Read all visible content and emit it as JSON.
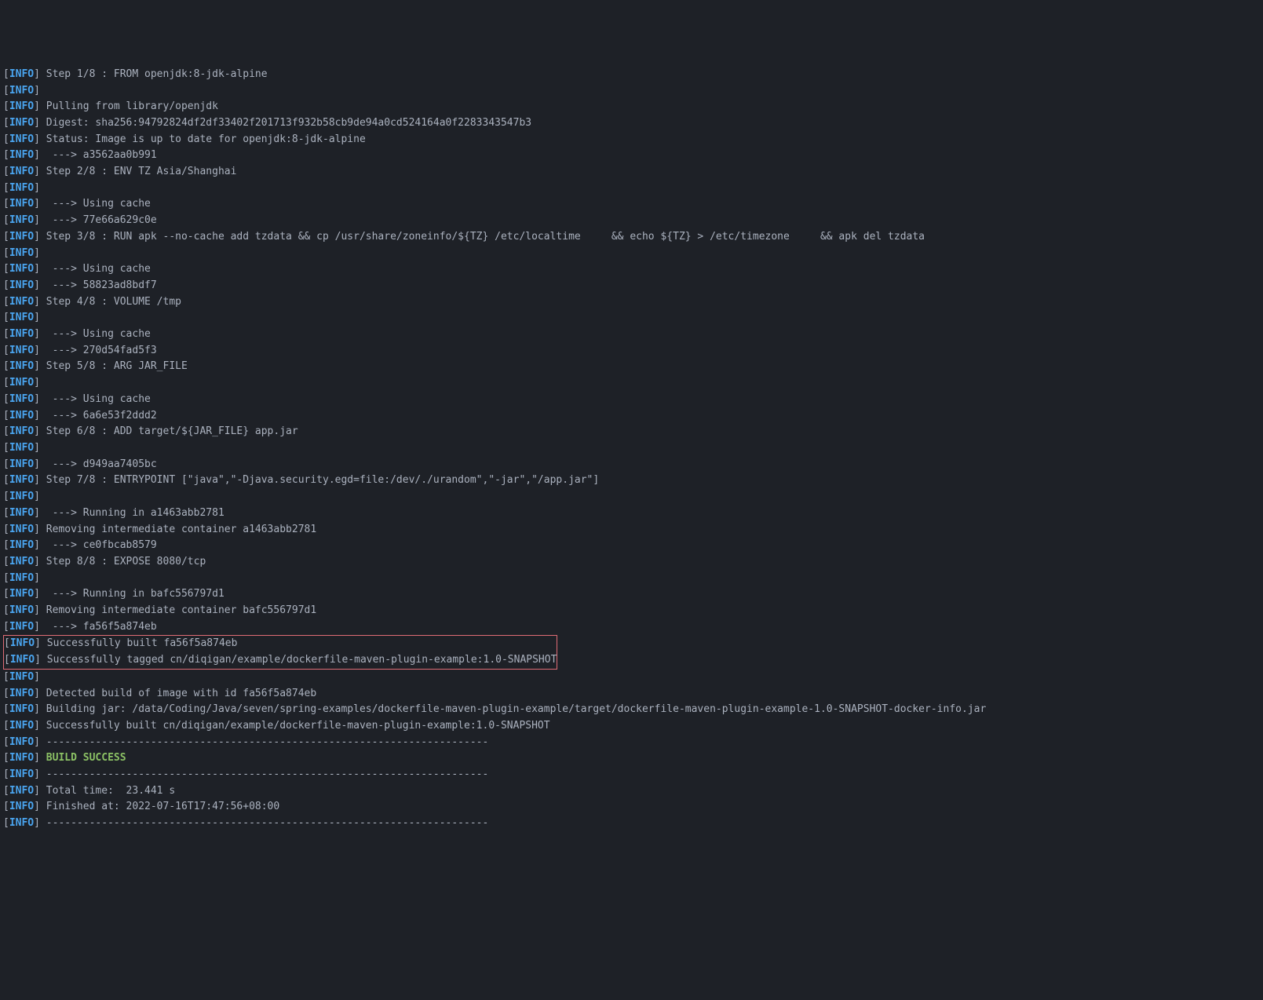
{
  "lines": [
    {
      "level": "INFO",
      "msg": "Step 1/8 : FROM openjdk:8-jdk-alpine"
    },
    {
      "level": "INFO",
      "msg": ""
    },
    {
      "level": "INFO",
      "msg": "Pulling from library/openjdk"
    },
    {
      "level": "INFO",
      "msg": "Digest: sha256:94792824df2df33402f201713f932b58cb9de94a0cd524164a0f2283343547b3"
    },
    {
      "level": "INFO",
      "msg": "Status: Image is up to date for openjdk:8-jdk-alpine"
    },
    {
      "level": "INFO",
      "msg": " ---> a3562aa0b991"
    },
    {
      "level": "INFO",
      "msg": "Step 2/8 : ENV TZ Asia/Shanghai"
    },
    {
      "level": "INFO",
      "msg": ""
    },
    {
      "level": "INFO",
      "msg": " ---> Using cache"
    },
    {
      "level": "INFO",
      "msg": " ---> 77e66a629c0e"
    },
    {
      "level": "INFO",
      "msg": "Step 3/8 : RUN apk --no-cache add tzdata && cp /usr/share/zoneinfo/${TZ} /etc/localtime     && echo ${TZ} > /etc/timezone     && apk del tzdata"
    },
    {
      "level": "INFO",
      "msg": ""
    },
    {
      "level": "INFO",
      "msg": " ---> Using cache"
    },
    {
      "level": "INFO",
      "msg": " ---> 58823ad8bdf7"
    },
    {
      "level": "INFO",
      "msg": "Step 4/8 : VOLUME /tmp"
    },
    {
      "level": "INFO",
      "msg": ""
    },
    {
      "level": "INFO",
      "msg": " ---> Using cache"
    },
    {
      "level": "INFO",
      "msg": " ---> 270d54fad5f3"
    },
    {
      "level": "INFO",
      "msg": "Step 5/8 : ARG JAR_FILE"
    },
    {
      "level": "INFO",
      "msg": ""
    },
    {
      "level": "INFO",
      "msg": " ---> Using cache"
    },
    {
      "level": "INFO",
      "msg": " ---> 6a6e53f2ddd2"
    },
    {
      "level": "INFO",
      "msg": "Step 6/8 : ADD target/${JAR_FILE} app.jar"
    },
    {
      "level": "INFO",
      "msg": ""
    },
    {
      "level": "INFO",
      "msg": " ---> d949aa7405bc"
    },
    {
      "level": "INFO",
      "msg": "Step 7/8 : ENTRYPOINT [\"java\",\"-Djava.security.egd=file:/dev/./urandom\",\"-jar\",\"/app.jar\"]"
    },
    {
      "level": "INFO",
      "msg": ""
    },
    {
      "level": "INFO",
      "msg": " ---> Running in a1463abb2781"
    },
    {
      "level": "INFO",
      "msg": "Removing intermediate container a1463abb2781"
    },
    {
      "level": "INFO",
      "msg": " ---> ce0fbcab8579"
    },
    {
      "level": "INFO",
      "msg": "Step 8/8 : EXPOSE 8080/tcp"
    },
    {
      "level": "INFO",
      "msg": ""
    },
    {
      "level": "INFO",
      "msg": " ---> Running in bafc556797d1"
    },
    {
      "level": "INFO",
      "msg": "Removing intermediate container bafc556797d1"
    },
    {
      "level": "INFO",
      "msg": " ---> fa56f5a874eb"
    }
  ],
  "highlighted": [
    {
      "level": "INFO",
      "msg": "Successfully built fa56f5a874eb"
    },
    {
      "level": "INFO",
      "msg": "Successfully tagged cn/diqigan/example/dockerfile-maven-plugin-example:1.0-SNAPSHOT"
    }
  ],
  "after": [
    {
      "level": "INFO",
      "msg": ""
    },
    {
      "level": "INFO",
      "msg": "Detected build of image with id fa56f5a874eb"
    },
    {
      "level": "INFO",
      "msg": "Building jar: /data/Coding/Java/seven/spring-examples/dockerfile-maven-plugin-example/target/dockerfile-maven-plugin-example-1.0-SNAPSHOT-docker-info.jar"
    },
    {
      "level": "INFO",
      "msg": "Successfully built cn/diqigan/example/dockerfile-maven-plugin-example:1.0-SNAPSHOT"
    },
    {
      "level": "INFO",
      "msg": "------------------------------------------------------------------------"
    },
    {
      "level": "INFO",
      "msg": "BUILD SUCCESS",
      "success": true
    },
    {
      "level": "INFO",
      "msg": "------------------------------------------------------------------------"
    },
    {
      "level": "INFO",
      "msg": "Total time:  23.441 s"
    },
    {
      "level": "INFO",
      "msg": "Finished at: 2022-07-16T17:47:56+08:00"
    },
    {
      "level": "INFO",
      "msg": "------------------------------------------------------------------------"
    }
  ]
}
